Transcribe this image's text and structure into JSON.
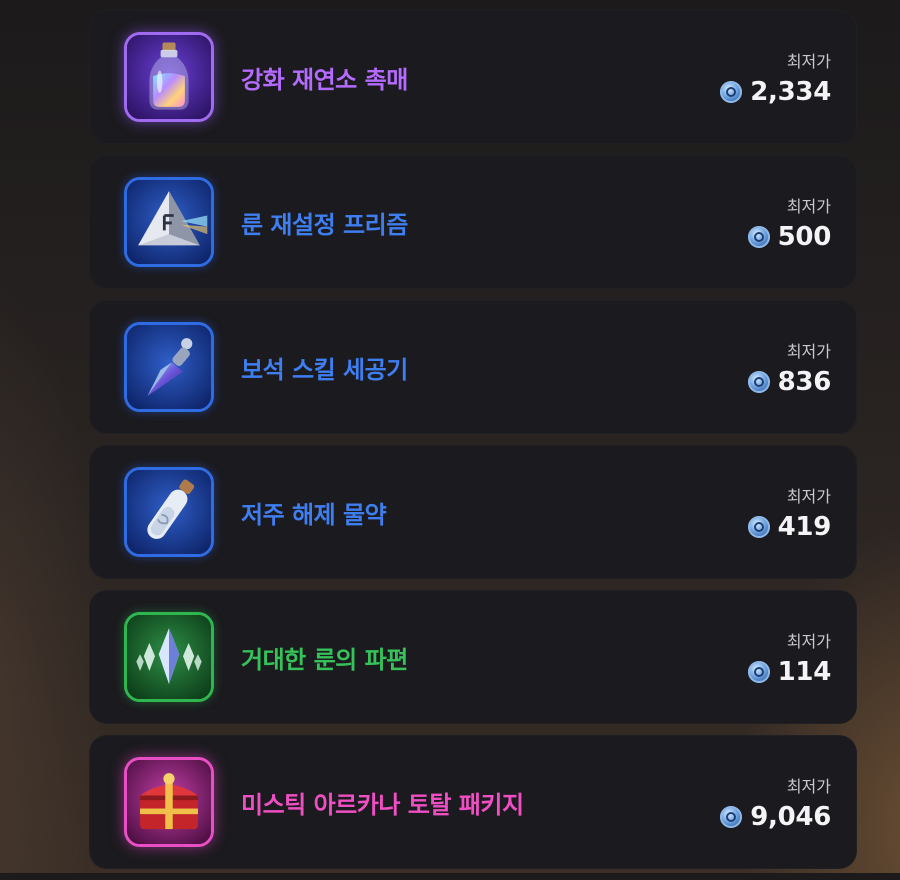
{
  "price_label": "최저가",
  "colors": {
    "purple": "#b46bff",
    "blue": "#3f7ef0",
    "green": "#35c25a",
    "pink": "#ef4fc3",
    "coin": "#6fa3e0"
  },
  "items": [
    {
      "name": "강화 재연소 촉매",
      "price": "2,334",
      "color": "#b46bff",
      "icon": "bottle-icon"
    },
    {
      "name": "룬 재설정 프리즘",
      "price": "500",
      "color": "#3f7ef0",
      "icon": "prism-icon"
    },
    {
      "name": "보석 스킬 세공기",
      "price": "836",
      "color": "#3f7ef0",
      "icon": "crystal-tool-icon"
    },
    {
      "name": "저주 해제 물약",
      "price": "419",
      "color": "#3f7ef0",
      "icon": "potion-vial-icon"
    },
    {
      "name": "거대한 룬의 파편",
      "price": "114",
      "color": "#35c25a",
      "icon": "rune-shard-icon"
    },
    {
      "name": "미스틱 아르카나 토탈 패키지",
      "price": "9,046",
      "color": "#ef4fc3",
      "icon": "treasure-chest-icon"
    }
  ]
}
